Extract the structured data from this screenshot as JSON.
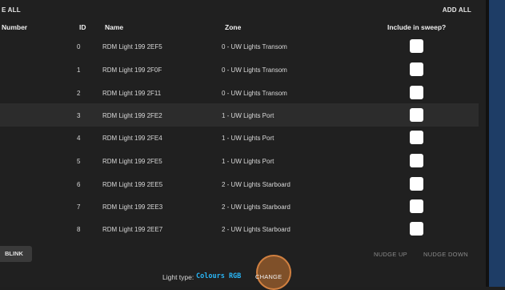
{
  "top": {
    "left_label": "E ALL",
    "right_label": "ADD ALL"
  },
  "columns": {
    "number": "Number",
    "id": "ID",
    "name": "Name",
    "zone": "Zone",
    "include": "Include in sweep?"
  },
  "rows": [
    {
      "id": "0",
      "name": "RDM Light 199 2EF5",
      "zone": "0 - UW Lights Transom"
    },
    {
      "id": "1",
      "name": "RDM Light 199 2F0F",
      "zone": "0 - UW Lights Transom"
    },
    {
      "id": "2",
      "name": "RDM Light 199 2F11",
      "zone": "0 - UW Lights Transom"
    },
    {
      "id": "3",
      "name": "RDM Light 199 2FE2",
      "zone": "1 - UW Lights Port"
    },
    {
      "id": "4",
      "name": "RDM Light 199 2FE4",
      "zone": "1 - UW Lights Port"
    },
    {
      "id": "5",
      "name": "RDM Light 199 2FE5",
      "zone": "1 - UW Lights Port"
    },
    {
      "id": "6",
      "name": "RDM Light 199 2EE5",
      "zone": "2 - UW Lights Starboard"
    },
    {
      "id": "7",
      "name": "RDM Light 199 2EE3",
      "zone": "2 - UW Lights Starboard"
    },
    {
      "id": "8",
      "name": "RDM Light 199 2EE7",
      "zone": "2 - UW Lights Starboard"
    }
  ],
  "actions": {
    "blink": "BLINK",
    "nudge_up": "NUDGE UP",
    "nudge_down": "NUDGE DOWN"
  },
  "footer": {
    "light_type_label": "Light type:",
    "light_type_value": "Colours RGB",
    "change": "CHANGE"
  },
  "colors": {
    "accent": "#29b6f6",
    "highlight_row": "#2c2c2c",
    "change_circle": "#ce7832"
  }
}
